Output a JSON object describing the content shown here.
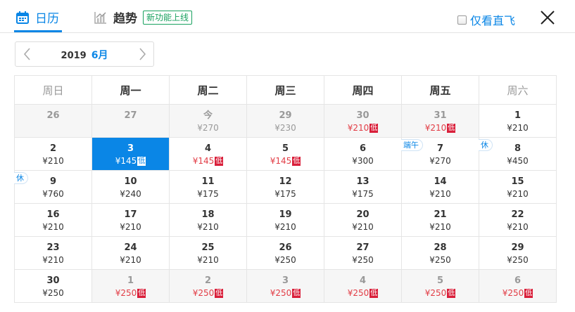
{
  "header": {
    "tab_calendar": "日历",
    "tab_trend": "趋势",
    "new_badge": "新功能上线",
    "direct_only": "仅看直飞"
  },
  "month_bar": {
    "year": "2019",
    "month": "6月"
  },
  "colors": {
    "accent": "#0a86e6",
    "low": "#d91f3a",
    "new": "#19a15f"
  },
  "weekdays": [
    "周日",
    "周一",
    "周二",
    "周三",
    "周四",
    "周五",
    "周六"
  ],
  "weeks": [
    [
      {
        "day": "26",
        "price": "",
        "state": "past"
      },
      {
        "day": "27",
        "price": "",
        "state": "past"
      },
      {
        "day": "今",
        "price": "¥270",
        "state": "past"
      },
      {
        "day": "29",
        "price": "¥230",
        "state": "past"
      },
      {
        "day": "30",
        "price": "¥210",
        "low": "低",
        "state": "past"
      },
      {
        "day": "31",
        "price": "¥210",
        "low": "低",
        "state": "past"
      },
      {
        "day": "1",
        "price": "¥210"
      }
    ],
    [
      {
        "day": "2",
        "price": "¥210"
      },
      {
        "day": "3",
        "price": "¥145",
        "low": "低",
        "state": "selected"
      },
      {
        "day": "4",
        "price": "¥145",
        "low": "低"
      },
      {
        "day": "5",
        "price": "¥145",
        "low": "低"
      },
      {
        "day": "6",
        "price": "¥300"
      },
      {
        "day": "7",
        "price": "¥270",
        "holiday": "端午"
      },
      {
        "day": "8",
        "price": "¥450",
        "holiday": "休"
      }
    ],
    [
      {
        "day": "9",
        "price": "¥760",
        "holiday": "休"
      },
      {
        "day": "10",
        "price": "¥240"
      },
      {
        "day": "11",
        "price": "¥175"
      },
      {
        "day": "12",
        "price": "¥175"
      },
      {
        "day": "13",
        "price": "¥175"
      },
      {
        "day": "14",
        "price": "¥210"
      },
      {
        "day": "15",
        "price": "¥210"
      }
    ],
    [
      {
        "day": "16",
        "price": "¥210"
      },
      {
        "day": "17",
        "price": "¥210"
      },
      {
        "day": "18",
        "price": "¥210"
      },
      {
        "day": "19",
        "price": "¥210"
      },
      {
        "day": "20",
        "price": "¥210"
      },
      {
        "day": "21",
        "price": "¥210"
      },
      {
        "day": "22",
        "price": "¥210"
      }
    ],
    [
      {
        "day": "23",
        "price": "¥210"
      },
      {
        "day": "24",
        "price": "¥210"
      },
      {
        "day": "25",
        "price": "¥210"
      },
      {
        "day": "26",
        "price": "¥250"
      },
      {
        "day": "27",
        "price": "¥250"
      },
      {
        "day": "28",
        "price": "¥250"
      },
      {
        "day": "29",
        "price": "¥250"
      }
    ],
    [
      {
        "day": "30",
        "price": "¥250"
      },
      {
        "day": "1",
        "price": "¥250",
        "low": "低",
        "state": "other"
      },
      {
        "day": "2",
        "price": "¥250",
        "low": "低",
        "state": "other"
      },
      {
        "day": "3",
        "price": "¥250",
        "low": "低",
        "state": "other"
      },
      {
        "day": "4",
        "price": "¥250",
        "low": "低",
        "state": "other"
      },
      {
        "day": "5",
        "price": "¥250",
        "low": "低",
        "state": "other"
      },
      {
        "day": "6",
        "price": "¥250",
        "low": "低",
        "state": "other"
      }
    ]
  ]
}
